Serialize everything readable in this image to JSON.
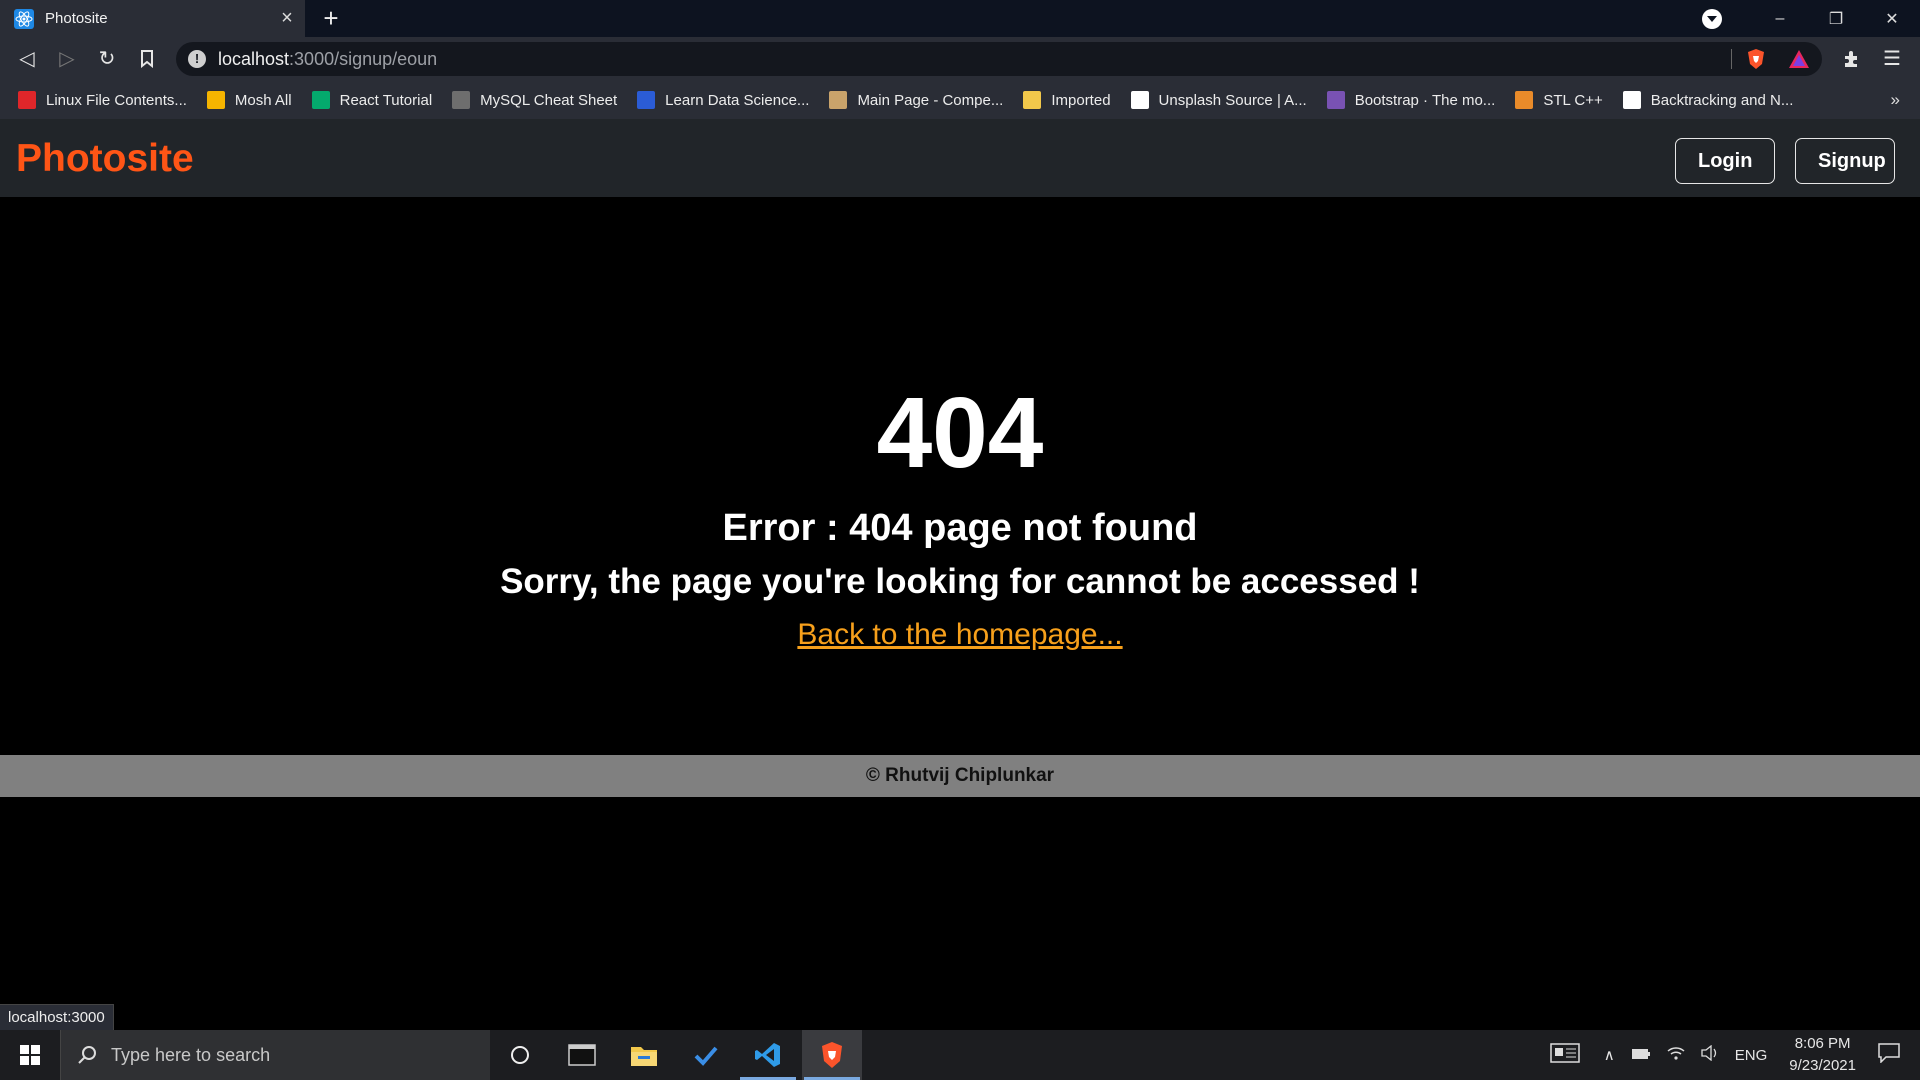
{
  "browser": {
    "tab": {
      "title": "Photosite",
      "close": "×"
    },
    "new_tab": "+",
    "address": {
      "host": "localhost",
      "path": ":3000/signup/eoun"
    },
    "bookmarks": [
      {
        "label": "Linux File Contents...",
        "icon": "linux-file-icon",
        "color": "#e0262a"
      },
      {
        "label": "Mosh All",
        "icon": "google-drive-icon",
        "color": "#f5b400"
      },
      {
        "label": "React Tutorial",
        "icon": "w3schools-icon",
        "color": "#04aa6d"
      },
      {
        "label": "MySQL Cheat Sheet",
        "icon": "github-icon",
        "color": "#6e6e6e"
      },
      {
        "label": "Learn Data Science...",
        "icon": "learn-data-science-icon",
        "color": "#2b5cd6"
      },
      {
        "label": "Main Page - Compe...",
        "icon": "wiki-icon",
        "color": "#c9a36b"
      },
      {
        "label": "Imported",
        "icon": "folder-icon",
        "color": "#f2c84b"
      },
      {
        "label": "Unsplash Source | A...",
        "icon": "unsplash-icon",
        "color": "#ffffff"
      },
      {
        "label": "Bootstrap · The mo...",
        "icon": "bootstrap-icon",
        "color": "#7952b3"
      },
      {
        "label": "STL C++",
        "icon": "geeksforgeeks-icon",
        "color": "#e98b2a"
      },
      {
        "label": "Backtracking and N...",
        "icon": "backtracking-icon",
        "color": "#ffffff"
      }
    ],
    "bookmarks_more": "»"
  },
  "app": {
    "brand": "Photosite",
    "nav": {
      "login": "Login",
      "signup": "Signup"
    },
    "error": {
      "code": "404",
      "title": "Error : 404 page not found",
      "message": "Sorry, the page you're looking for cannot be accessed !",
      "home_link": "Back to the homepage..."
    },
    "footer": "© Rhutvij Chiplunkar",
    "brand_color": "#ff5516",
    "link_color": "#f7a01b"
  },
  "status_bubble": "localhost:3000",
  "taskbar": {
    "search_placeholder": "Type here to search",
    "language": "ENG",
    "time": "8:06 PM",
    "date": "9/23/2021"
  }
}
